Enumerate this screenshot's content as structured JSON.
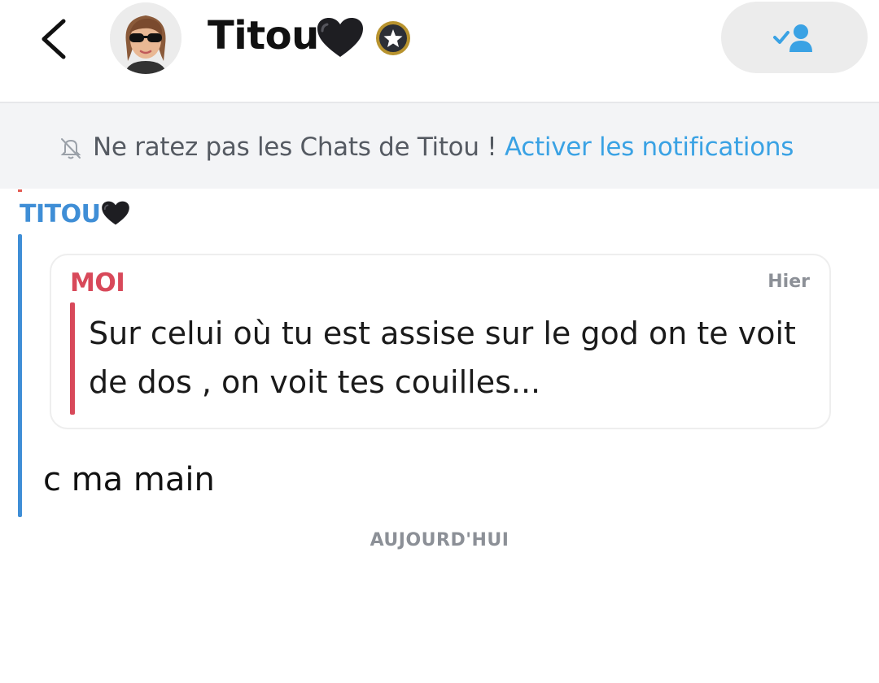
{
  "header": {
    "title": "Titou",
    "title_emoji_icon": "black-heart-icon",
    "badge_icon": "star-badge-icon",
    "back_icon": "chevron-left-icon",
    "friend_button_icon": "added-friend-icon"
  },
  "notification_banner": {
    "icon": "bell-off-icon",
    "text": "Ne ratez pas les Chats de Titou ! ",
    "link_label": "Activer les notifications"
  },
  "conversation": {
    "sender": "TITOU",
    "sender_emoji_icon": "black-heart-icon",
    "quoted": {
      "sender": "MOI",
      "time": "Hier",
      "text": "Sur celui où tu est assise sur le god on te voit de dos , on voit tes couilles..."
    },
    "message": "c ma main",
    "day_separator": "AUJOURD'HUI"
  },
  "colors": {
    "accent_blue": "#3aa2e4",
    "friend_blue": "#3f8ed6",
    "me_red": "#d8495a",
    "banner_bg": "#f3f4f6"
  }
}
